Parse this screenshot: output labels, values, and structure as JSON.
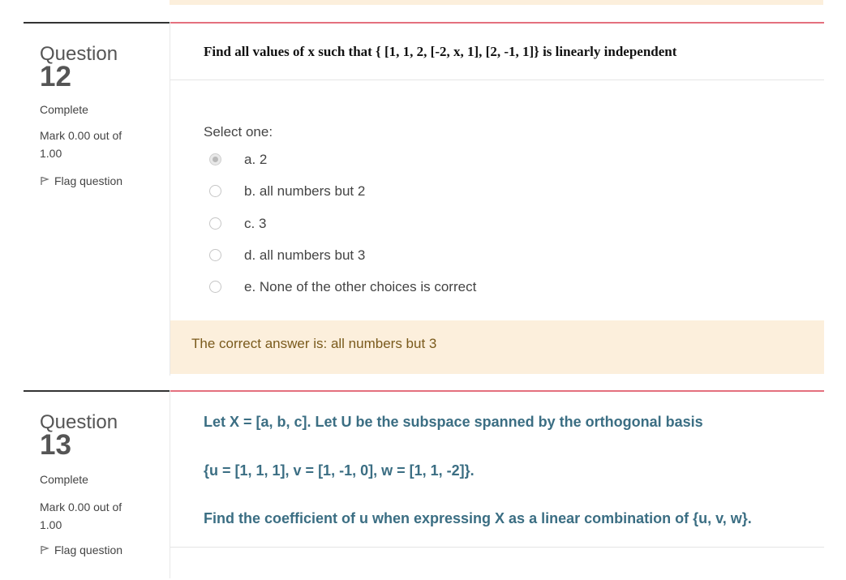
{
  "q12": {
    "label": "Question",
    "number": "12",
    "state": "Complete",
    "grade": "Mark 0.00 out of 1.00",
    "flag_label": "Flag question",
    "question_text": "Find all values of x such that { [1, 1, 2, [-2, x, 1], [2, -1, 1]} is linearly independent",
    "prompt": "Select one:",
    "options": [
      {
        "label": "a. 2",
        "checked": true
      },
      {
        "label": "b. all numbers but 2",
        "checked": false
      },
      {
        "label": "c. 3",
        "checked": false
      },
      {
        "label": "d. all numbers but 3",
        "checked": false
      },
      {
        "label": "e. None of the other choices is correct",
        "checked": false
      }
    ],
    "feedback": "The correct answer is: all numbers but 3"
  },
  "q13": {
    "label": "Question",
    "number": "13",
    "state": "Complete",
    "grade": "Mark 0.00 out of 1.00",
    "flag_label": "Flag question",
    "lines": [
      "Let X = [a, b, c]. Let U be the subspace spanned by the orthogonal basis",
      "{u = [1, 1, 1], v = [1, -1, 0], w = [1, 1, -2]}.",
      "Find the coefficient of u when expressing X as a linear combination of {u, v, w}."
    ]
  },
  "colors": {
    "accent_line": "#e4707e",
    "feedback_bg": "#fcefdc",
    "question_text_teal": "#3b6e83"
  },
  "icons": [
    "flag-icon",
    "radio-icon"
  ]
}
